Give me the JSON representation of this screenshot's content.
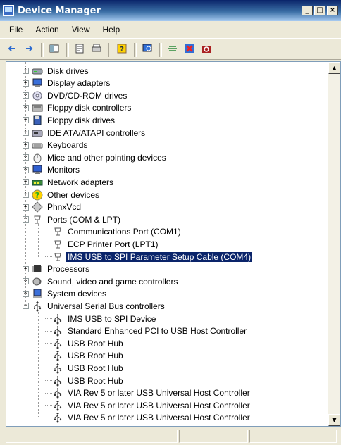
{
  "window": {
    "title": "Device Manager",
    "minimize": "_",
    "maximize": "□",
    "close": "×"
  },
  "menu": [
    "File",
    "Action",
    "View",
    "Help"
  ],
  "toolbar": {
    "buttons": [
      "back-arrow-icon",
      "forward-arrow-icon",
      "|",
      "show-hide-console-tree-icon",
      "|",
      "properties-icon",
      "print-icon",
      "|",
      "help-icon",
      "|",
      "scan-hardware-icon",
      "|",
      "update-driver-icon",
      "uninstall-icon",
      "disable-icon"
    ]
  },
  "tree": [
    {
      "label": "Disk drives",
      "icon": "disk-drive-icon",
      "depth": 0,
      "exp": "+"
    },
    {
      "label": "Display adapters",
      "icon": "display-adapter-icon",
      "depth": 0,
      "exp": "+"
    },
    {
      "label": "DVD/CD-ROM drives",
      "icon": "dvd-drive-icon",
      "depth": 0,
      "exp": "+"
    },
    {
      "label": "Floppy disk controllers",
      "icon": "floppy-controller-icon",
      "depth": 0,
      "exp": "+"
    },
    {
      "label": "Floppy disk drives",
      "icon": "floppy-drive-icon",
      "depth": 0,
      "exp": "+"
    },
    {
      "label": "IDE ATA/ATAPI controllers",
      "icon": "ide-controller-icon",
      "depth": 0,
      "exp": "+"
    },
    {
      "label": "Keyboards",
      "icon": "keyboard-icon",
      "depth": 0,
      "exp": "+"
    },
    {
      "label": "Mice and other pointing devices",
      "icon": "mouse-icon",
      "depth": 0,
      "exp": "+"
    },
    {
      "label": "Monitors",
      "icon": "monitor-icon",
      "depth": 0,
      "exp": "+"
    },
    {
      "label": "Network adapters",
      "icon": "network-adapter-icon",
      "depth": 0,
      "exp": "+"
    },
    {
      "label": "Other devices",
      "icon": "unknown-device-icon",
      "depth": 0,
      "exp": "+"
    },
    {
      "label": "PhnxVcd",
      "icon": "phnxvcd-icon",
      "depth": 0,
      "exp": "+"
    },
    {
      "label": "Ports (COM & LPT)",
      "icon": "port-icon",
      "depth": 0,
      "exp": "−"
    },
    {
      "label": "Communications Port (COM1)",
      "icon": "port-icon",
      "depth": 1
    },
    {
      "label": "ECP Printer Port (LPT1)",
      "icon": "port-icon",
      "depth": 1
    },
    {
      "label": "IMS USB to SPI Parameter Setup Cable (COM4)",
      "icon": "port-icon",
      "depth": 1,
      "selected": true
    },
    {
      "label": "Processors",
      "icon": "processor-icon",
      "depth": 0,
      "exp": "+"
    },
    {
      "label": "Sound, video and game controllers",
      "icon": "sound-icon",
      "depth": 0,
      "exp": "+"
    },
    {
      "label": "System devices",
      "icon": "system-device-icon",
      "depth": 0,
      "exp": "+"
    },
    {
      "label": "Universal Serial Bus controllers",
      "icon": "usb-icon",
      "depth": 0,
      "exp": "−"
    },
    {
      "label": "IMS USB to SPI Device",
      "icon": "usb-icon",
      "depth": 1
    },
    {
      "label": "Standard Enhanced PCI to USB Host Controller",
      "icon": "usb-icon",
      "depth": 1
    },
    {
      "label": "USB Root Hub",
      "icon": "usb-icon",
      "depth": 1
    },
    {
      "label": "USB Root Hub",
      "icon": "usb-icon",
      "depth": 1
    },
    {
      "label": "USB Root Hub",
      "icon": "usb-icon",
      "depth": 1
    },
    {
      "label": "USB Root Hub",
      "icon": "usb-icon",
      "depth": 1
    },
    {
      "label": "VIA Rev 5 or later USB Universal Host Controller",
      "icon": "usb-icon",
      "depth": 1
    },
    {
      "label": "VIA Rev 5 or later USB Universal Host Controller",
      "icon": "usb-icon",
      "depth": 1
    },
    {
      "label": "VIA Rev 5 or later USB Universal Host Controller",
      "icon": "usb-icon",
      "depth": 1
    }
  ],
  "status": [
    "",
    "",
    ""
  ]
}
